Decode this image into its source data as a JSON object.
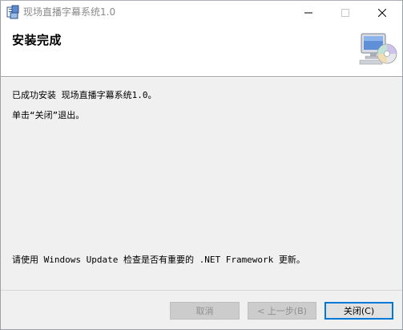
{
  "window": {
    "title": "现场直播字幕系统1.0"
  },
  "header": {
    "title": "安装完成"
  },
  "body": {
    "line1": "已成功安装 现场直播字幕系统1.0。",
    "line2": "单击“关闭”退出。",
    "line3": "请使用 Windows Update 检查是否有重要的 .NET Framework 更新。"
  },
  "buttons": {
    "cancel": "取消",
    "back": "< 上一步(B)",
    "close": "关闭(C)"
  },
  "icons": {
    "app": "installer-icon",
    "header": "computer-cd-icon",
    "minimize": "minimize-icon",
    "maximize": "maximize-icon",
    "close": "close-icon"
  },
  "colors": {
    "default_button_border": "#0078d7",
    "disabled_button_bg": "#cccccc"
  }
}
